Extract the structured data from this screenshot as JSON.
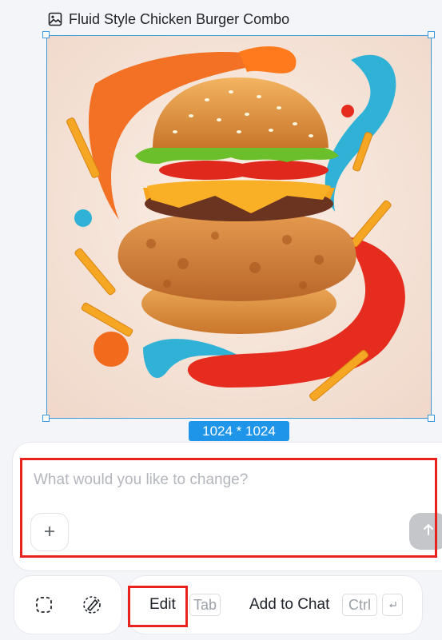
{
  "header": {
    "title": "Fluid Style Chicken Burger Combo",
    "icon": "image-icon"
  },
  "canvas": {
    "alt": "Fluid style chicken burger with orange, blue and red liquid splashes and fries",
    "dimension_badge": "1024 * 1024",
    "selection_color": "#3a9bdc"
  },
  "prompt": {
    "placeholder": "What would you like to change?",
    "value": "",
    "add_icon": "plus-icon",
    "send_icon": "arrow-up-icon"
  },
  "toolbar": {
    "tools": [
      {
        "icon": "dashed-select-icon"
      },
      {
        "icon": "eraser-brush-icon"
      }
    ],
    "edit_label": "Edit",
    "edit_shortcut": "Tab",
    "add_to_chat_label": "Add to Chat",
    "add_to_chat_shortcut": "Ctrl",
    "enter_key_icon": "enter-key-icon"
  },
  "colors": {
    "accent": "#1e95e8",
    "highlight": "#e8231f",
    "send_disabled": "#c4c6ca"
  }
}
